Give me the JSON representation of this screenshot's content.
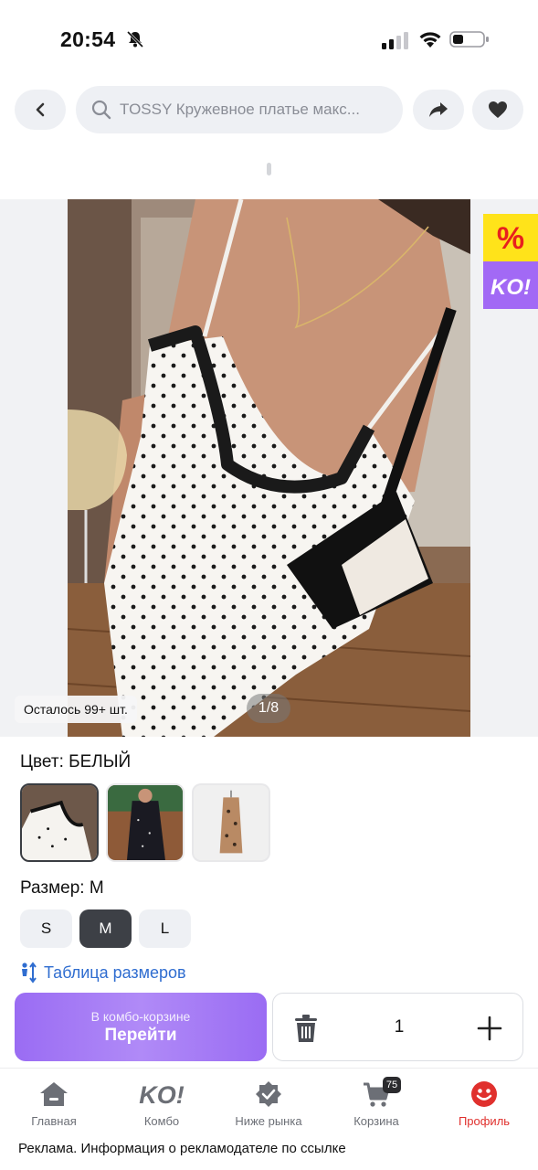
{
  "status_bar": {
    "time": "20:54",
    "icons": [
      "bell-muted-icon",
      "signal-icon",
      "wifi-icon",
      "battery-icon"
    ]
  },
  "top_nav": {
    "back_icon": "chevron-left-icon",
    "search_text": "TOSSY Кружевное платье макс...",
    "share_icon": "share-arrow-icon",
    "favorite_icon": "heart-icon"
  },
  "gallery": {
    "stock_text": "Осталось 99+ шт.",
    "page_counter": "1/8",
    "promo_badge": {
      "percent_symbol": "%",
      "brand": "KO!"
    }
  },
  "color": {
    "label": "Цвет: БЕЛЫЙ",
    "options": [
      {
        "name": "white-polka",
        "selected": true
      },
      {
        "name": "black-polka",
        "selected": false
      },
      {
        "name": "leopard",
        "selected": false
      }
    ]
  },
  "size": {
    "label": "Размер: M",
    "options": [
      "S",
      "M",
      "L"
    ],
    "selected": "M"
  },
  "size_table_link": "Таблица размеров",
  "cart": {
    "combo_subtitle": "В комбо-корзине",
    "combo_title": "Перейти",
    "quantity": "1"
  },
  "tabbar": {
    "items": [
      {
        "label": "Главная",
        "icon": "home-icon"
      },
      {
        "label": "Комбо",
        "icon": "ko-logo-icon"
      },
      {
        "label": "Ниже рынка",
        "icon": "badge-check-icon"
      },
      {
        "label": "Корзина",
        "icon": "cart-icon",
        "badge": "75"
      },
      {
        "label": "Профиль",
        "icon": "profile-smile-icon",
        "active": true
      }
    ]
  },
  "ad_note": "Реклама. Информация о рекламодателе по ссылке",
  "colors": {
    "accent_purple": "#9a6cf3",
    "active_red": "#e0302d",
    "link_blue": "#2f6dd0"
  }
}
